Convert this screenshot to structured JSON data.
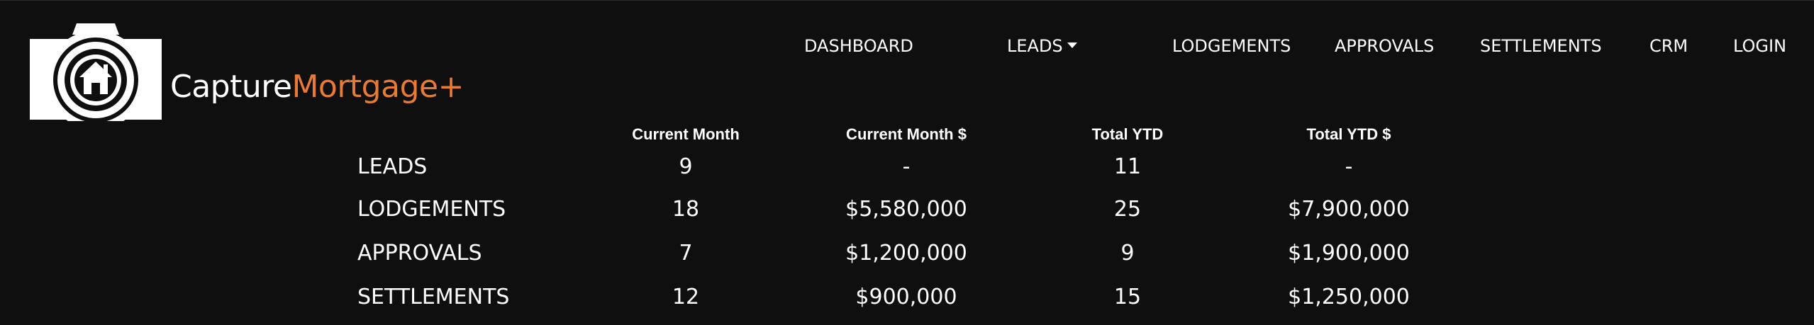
{
  "brand": {
    "name_part1": "Capture",
    "name_part2": "Mortgage+",
    "accent_color": "#e87a35",
    "background_color": "#0f0f0f",
    "logo_icon": "camera-house-icon"
  },
  "nav": {
    "items": [
      {
        "label": "DASHBOARD"
      },
      {
        "label": "LEADS",
        "icon": "caret-down-icon"
      },
      {
        "label": "LODGEMENTS"
      },
      {
        "label": "APPROVALS"
      },
      {
        "label": "SETTLEMENTS"
      },
      {
        "label": "CRM"
      },
      {
        "label": "LOGIN"
      }
    ]
  },
  "stats": {
    "columns": [
      "Current Month",
      "Current Month $",
      "Total YTD",
      "Total YTD $"
    ],
    "rows": [
      {
        "label": "LEADS",
        "values": [
          "9",
          "-",
          "11",
          "-"
        ]
      },
      {
        "label": "LODGEMENTS",
        "values": [
          "18",
          "$5,580,000",
          "25",
          "$7,900,000"
        ]
      },
      {
        "label": "APPROVALS",
        "values": [
          "7",
          "$1,200,000",
          "9",
          "$1,900,000"
        ]
      },
      {
        "label": "SETTLEMENTS",
        "values": [
          "12",
          "$900,000",
          "15",
          "$1,250,000"
        ]
      }
    ]
  }
}
